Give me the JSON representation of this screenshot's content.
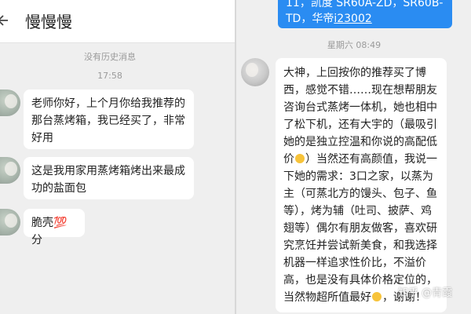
{
  "left_chat": {
    "title": "慢慢慢",
    "no_history": "没有历史消息",
    "time": "17:58",
    "messages": [
      {
        "text": "老师你好，上个月你给我推荐的那台蒸烤箱，我已经买了，非常好用"
      },
      {
        "text": "这是我用家用蒸烤箱烤出来最成功的盐面包"
      },
      {
        "text": "脆壳💯分"
      }
    ]
  },
  "right_chat": {
    "sent_message": {
      "line1": "11，凯度 SR60A-ZD，SR60B-",
      "line2_before": "TD，华帝",
      "line2_link": "i23002"
    },
    "timestamp": "星期六 08:49",
    "reply": {
      "text_before_emoji": "大神，上回按你的推荐买了博西，感觉不错……现在想帮朋友咨询台式蒸烤一体机，她也相中了松下机，还有大宇的（最吸引她的是独立控温和你说的高配低价",
      "text_middle": "）当然还有高颜值，我说一下她的需求：3口之家，以蒸为主（可蒸北方的馒头、包子、鱼等），烤为辅（吐司、披萨、鸡翅等）偶尔有朋友做客，喜欢研究烹饪并尝试新美食，和我选择机器一样追求性价比，不溢价高，也是没有具体价格定位的，当然物超所值最好",
      "text_end": "，谢谢！"
    }
  },
  "watermark": "知乎 @青霞",
  "colors": {
    "sent_bubble": "#2a8cf2",
    "received_bubble": "#ffffff",
    "background": "#efefef"
  }
}
